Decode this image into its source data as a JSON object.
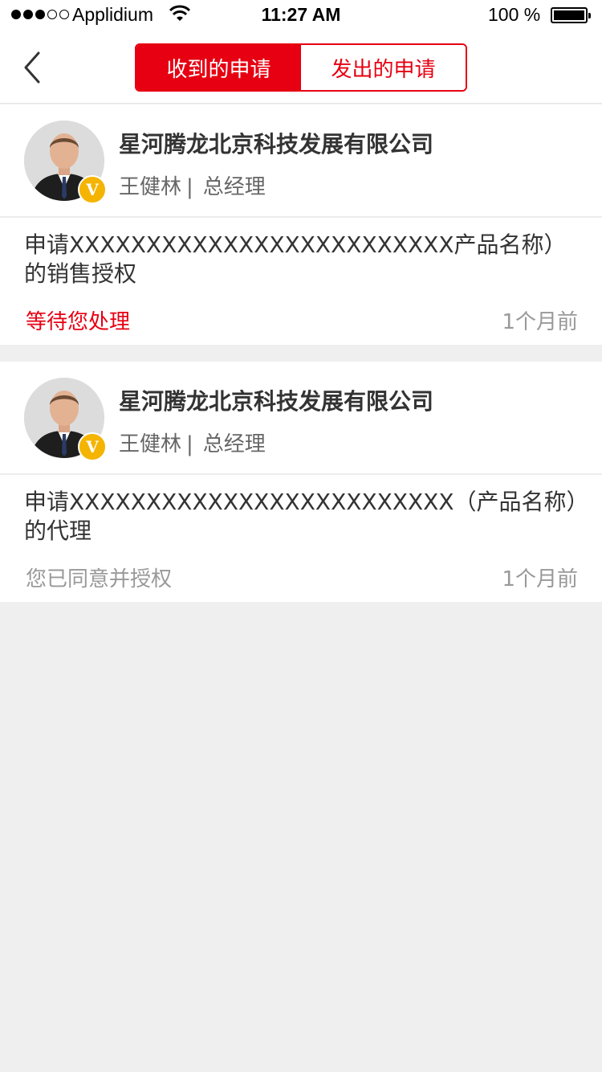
{
  "status_bar": {
    "carrier": "Applidium",
    "time": "11:27 AM",
    "battery": "100 %"
  },
  "nav": {
    "tabs": [
      {
        "label": "收到的申请",
        "active": true
      },
      {
        "label": "发出的申请",
        "active": false
      }
    ]
  },
  "requests": [
    {
      "company": "星河腾龙北京科技发展有限公司",
      "name": "王健林",
      "title": "总经理",
      "badge": "V",
      "text": "申请XXXXXXXXXXXXXXXXXXXXXXXXX产品名称）的销售授权",
      "status": "等待您处理",
      "time": "1个月前"
    },
    {
      "company": "星河腾龙北京科技发展有限公司",
      "name": "王健林",
      "title": "总经理",
      "badge": "V",
      "text": "申请XXXXXXXXXXXXXXXXXXXXXXXXX（产品名称）的代理",
      "status": "您已同意并授权",
      "time": "1个月前"
    }
  ],
  "colors": {
    "accent": "#e60012",
    "badge": "#f4b400",
    "background": "#efefef"
  }
}
